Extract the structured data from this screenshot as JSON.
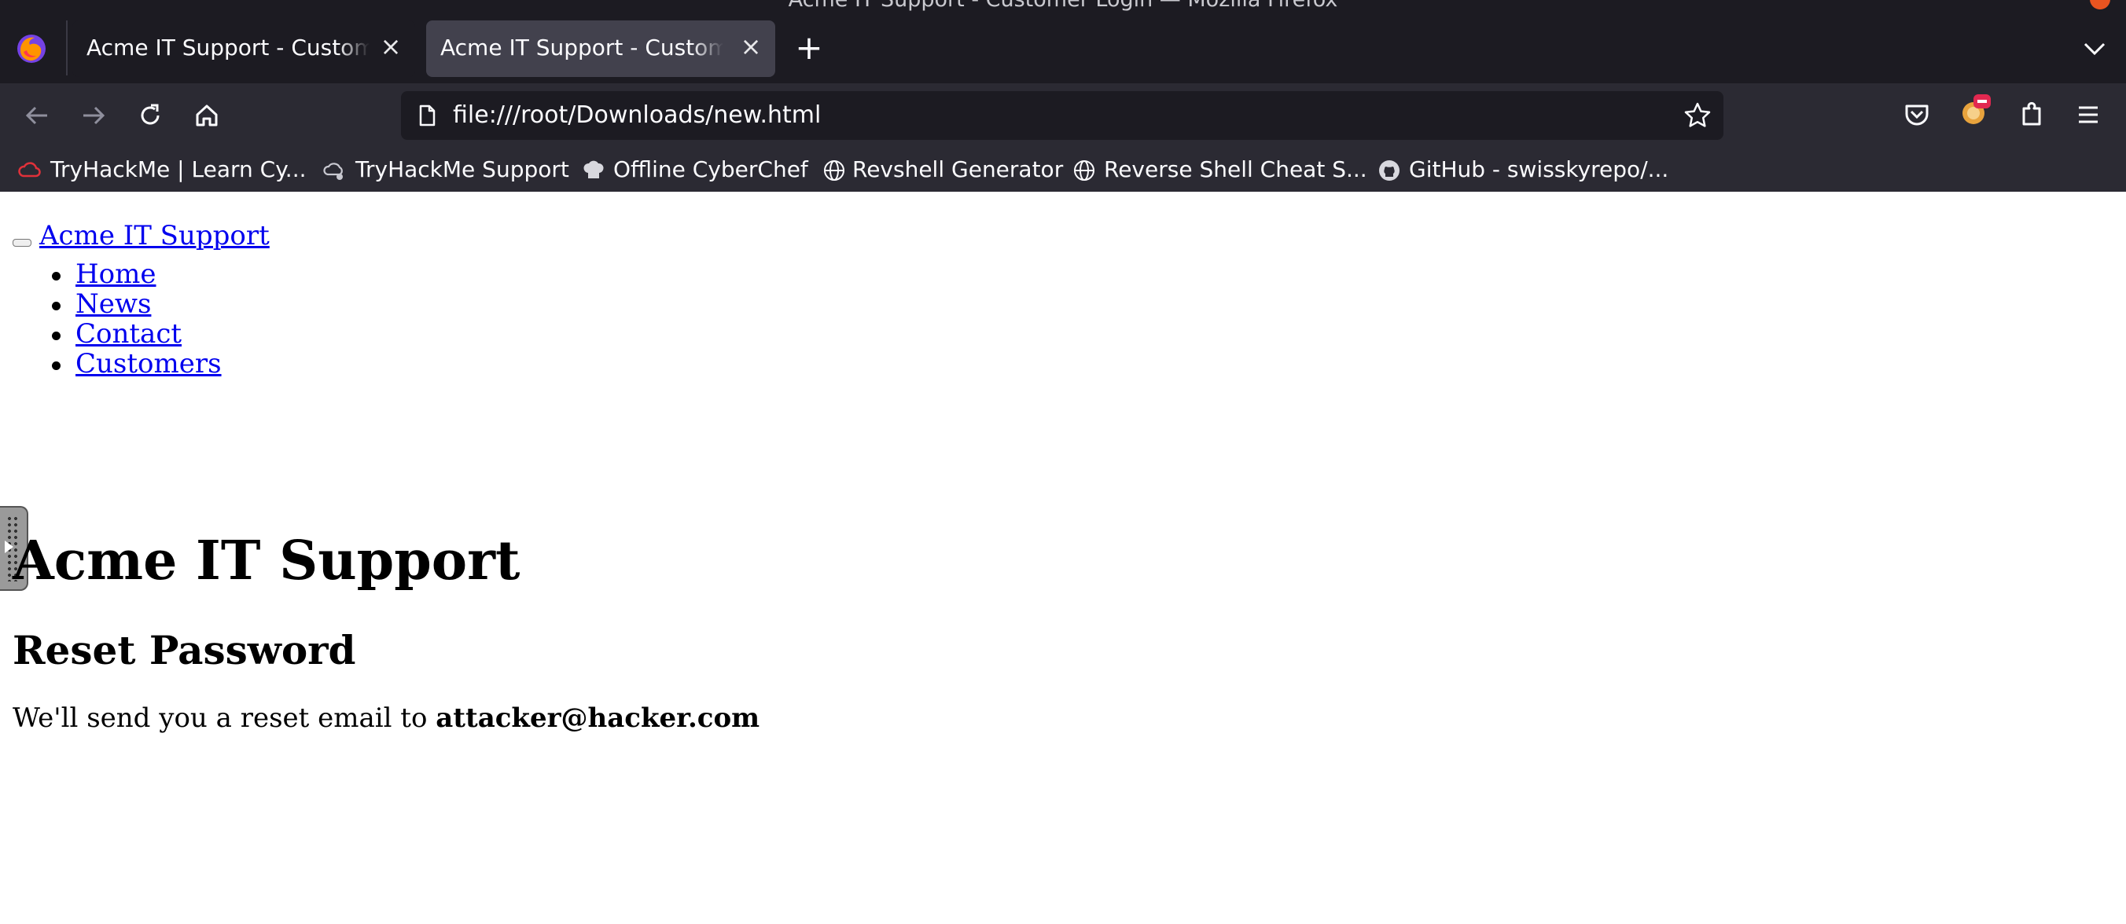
{
  "window": {
    "title": "Acme IT Support - Customer Login — Mozilla Firefox"
  },
  "tabs": [
    {
      "label": "Acme IT Support - Customer Login",
      "active": false
    },
    {
      "label": "Acme IT Support - Customer Login",
      "active": true
    }
  ],
  "toolbar": {
    "url": "file:///root/Downloads/new.html"
  },
  "bookmarks": [
    {
      "label": "TryHackMe | Learn Cy...",
      "icon": "tryhackme-cloud-icon"
    },
    {
      "label": "TryHackMe Support",
      "icon": "tryhackme-support-icon"
    },
    {
      "label": "Offline CyberChef",
      "icon": "chef-hat-icon"
    },
    {
      "label": "Revshell Generator",
      "icon": "globe-icon"
    },
    {
      "label": "Reverse Shell Cheat S...",
      "icon": "globe-icon"
    },
    {
      "label": "GitHub - swisskyrepo/...",
      "icon": "github-icon"
    }
  ],
  "page": {
    "brand": "Acme IT Support",
    "nav": [
      "Home",
      "News",
      "Contact",
      "Customers"
    ],
    "heading": "Acme IT Support",
    "subheading": "Reset Password",
    "message_prefix": "We'll send you a reset email to",
    "email": "attacker@hacker.com"
  },
  "colors": {
    "chrome_dark": "#1c1b22",
    "chrome_toolbar": "#2b2a33",
    "active_tab": "#42414d",
    "link": "#0000ee"
  }
}
